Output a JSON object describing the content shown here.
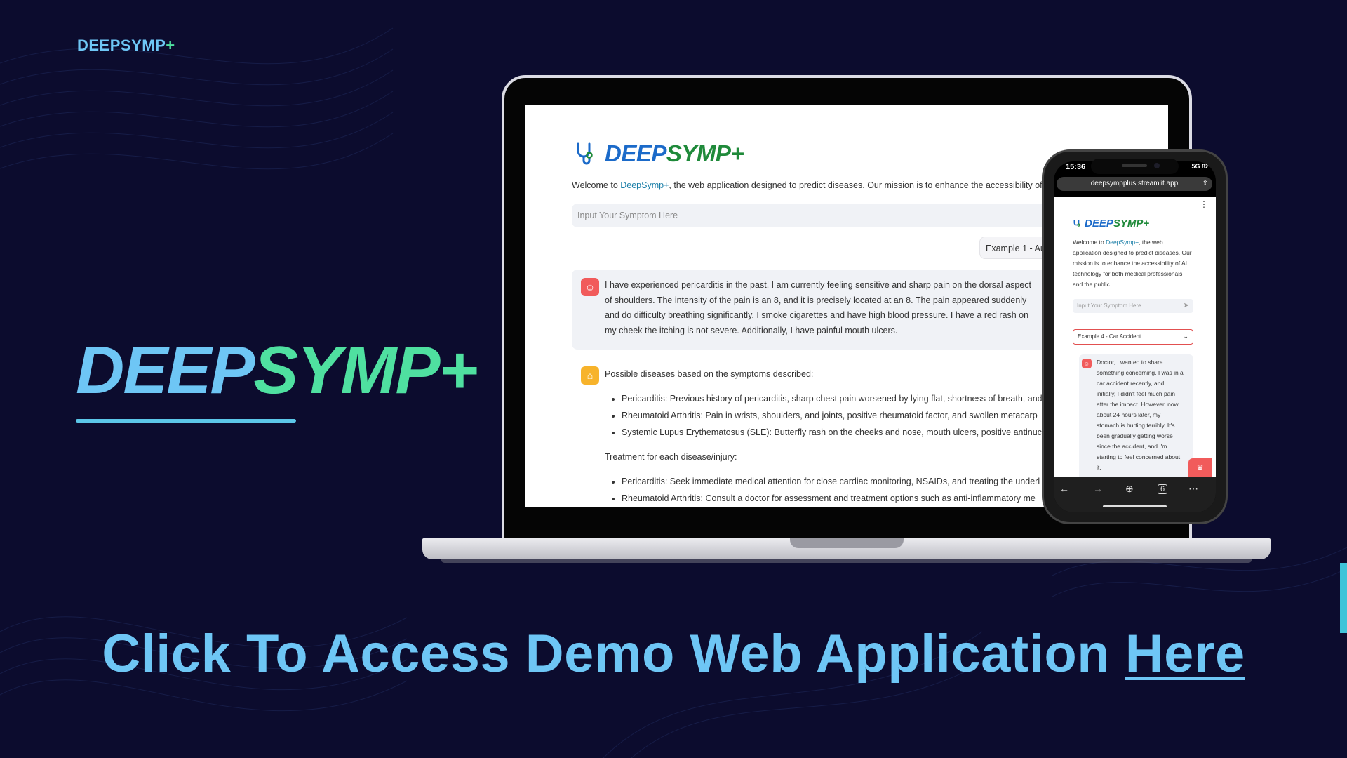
{
  "slide": {
    "corner_brand": {
      "part1": "DEEPSYMP",
      "part2": "+"
    },
    "hero_title": {
      "part1": "DEEP",
      "part2": "SYMP+"
    },
    "cta": {
      "text": "Click To Access Demo Web Application ",
      "link": "Here"
    },
    "colors": {
      "background": "#0c0c2e",
      "accent_blue": "#6ec6f5",
      "accent_green": "#4fe0a0"
    }
  },
  "laptop": {
    "logo": {
      "part1": "DEEP",
      "part2": "SYMP+",
      "icon": "stethoscope-icon"
    },
    "welcome": {
      "prefix": "Welcome to ",
      "link": "DeepSymp+",
      "suffix": ", the web application designed to predict diseases. Our mission is to enhance the accessibility of"
    },
    "input_placeholder": "Input Your Symptom Here",
    "example_label": "Example 1 - Au",
    "user_message": "I have experienced pericarditis in the past. I am currently feeling sensitive and sharp pain on the dorsal aspect of shoulders. The intensity of the pain is an 8, and it is precisely located at an 8. The pain appeared suddenly and do difficulty breathing significantly. I smoke cigarettes and have high blood pressure. I have a red rash on my cheek the itching is not severe. Additionally, I have painful mouth ulcers.",
    "response": {
      "intro": "Possible diseases based on the symptoms described:",
      "diseases": [
        "Pericarditis: Previous history of pericarditis, sharp chest pain worsened by lying flat, shortness of breath, and",
        "Rheumatoid Arthritis: Pain in wrists, shoulders, and joints, positive rheumatoid factor, and swollen metacarp",
        "Systemic Lupus Erythematosus (SLE): Butterfly rash on the cheeks and nose, mouth ulcers, positive antinucl"
      ],
      "treatment_label": "Treatment for each disease/injury:",
      "treatments": [
        "Pericarditis: Seek immediate medical attention for close cardiac monitoring, NSAIDs, and treating the underl",
        "Rheumatoid Arthritis: Consult a doctor for assessment and treatment options such as anti-inflammatory me"
      ]
    }
  },
  "phone": {
    "status": {
      "time": "15:36",
      "network": "5G",
      "battery": "82"
    },
    "url": "deepsympplus.streamlit.app",
    "logo": {
      "part1": "DEEP",
      "part2": "SYMP+"
    },
    "welcome": {
      "prefix": "Welcome to ",
      "link": "DeepSymp+",
      "suffix": ", the web application designed to predict diseases. Our mission is to enhance the accessibility of AI technology for both medical professionals and the public."
    },
    "input_placeholder": "Input Your Symptom Here",
    "select_value": "Example 4 - Car Accident",
    "message": "Doctor, I wanted to share something concerning. I was in a car accident recently, and initially, I didn't feel much pain after the impact. However, now, about 24 hours later, my stomach is hurting terribly. It's been gradually getting worse since the accident, and I'm starting to feel concerned about it.",
    "tab_count": "6"
  }
}
